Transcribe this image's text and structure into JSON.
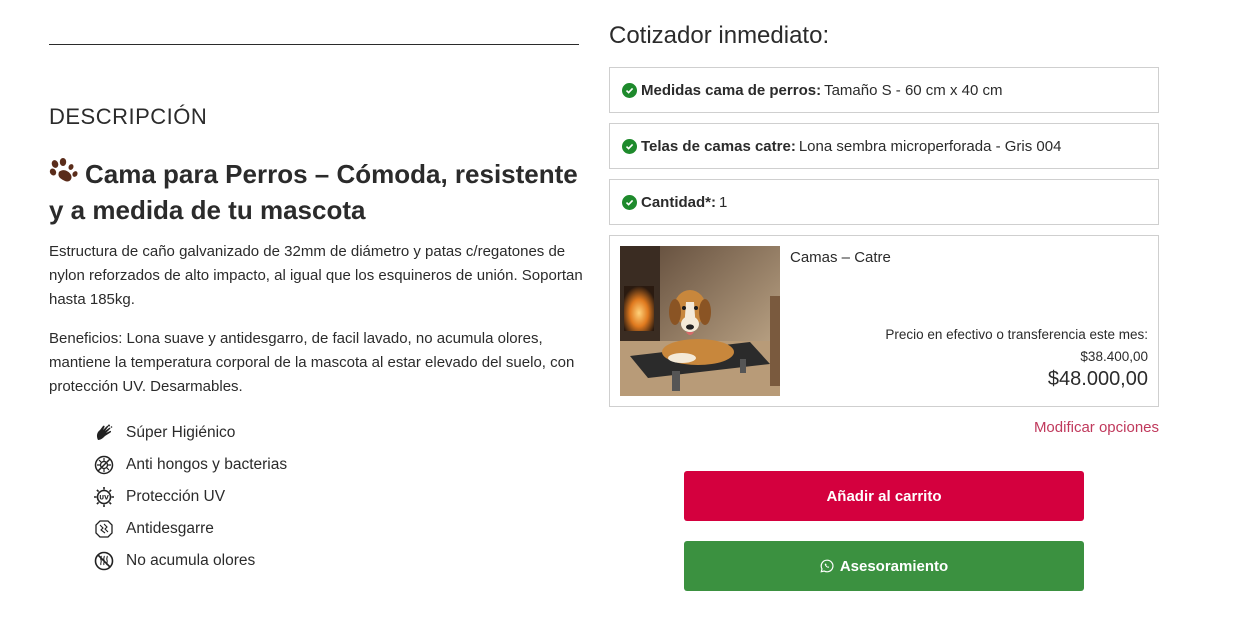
{
  "description": {
    "heading": "DESCRIPCIÓN",
    "title": "Cama para Perros – Cómoda, resistente y a medida de tu mascota",
    "paragraph1": "Estructura de caño galvanizado de 32mm de diámetro y patas c/regatones de nylon reforzados de alto impacto, al igual que los esquineros de unión. Soportan hasta 185kg.",
    "paragraph2": "Beneficios: Lona suave y antidesgarro, de facil lavado, no acumula olores, mantiene la temperatura corporal de la mascota al estar elevado del suelo, con protección UV. Desarmables.",
    "features": [
      {
        "label": "Súper Higiénico",
        "icon": "hand-wash-icon"
      },
      {
        "label": "Anti hongos y bacterias",
        "icon": "anti-bacteria-icon"
      },
      {
        "label": "Protección UV",
        "icon": "uv-icon"
      },
      {
        "label": "Antidesgarre",
        "icon": "anti-tear-icon"
      },
      {
        "label": "No acumula olores",
        "icon": "no-odor-icon"
      }
    ]
  },
  "quote": {
    "title": "Cotizador inmediato:",
    "options": [
      {
        "label": "Medidas cama de perros:",
        "value": "Tamaño S - 60 cm x 40 cm"
      },
      {
        "label": "Telas de camas catre:",
        "value": "Lona sembra microperforada - Gris 004"
      },
      {
        "label": "Cantidad*:",
        "value": "1"
      }
    ],
    "summary": {
      "product_name": "Camas – Catre",
      "cash_note": "Precio en efectivo o transferencia este mes:",
      "cash_price": "$38.400,00",
      "price": "$48.000,00"
    },
    "modify_label": "Modificar opciones",
    "add_to_cart_label": "Añadir al carrito",
    "advice_label": "Asesoramiento"
  },
  "colors": {
    "primary_button": "#d4003e",
    "whatsapp_button": "#3b9140",
    "check": "#1e8a2c",
    "link": "#c0395c"
  }
}
